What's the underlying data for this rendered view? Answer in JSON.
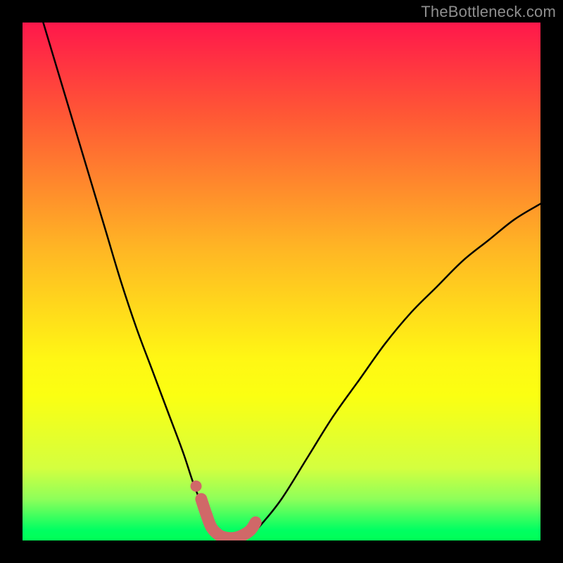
{
  "watermark": "TheBottleneck.com",
  "colors": {
    "gradient_top": "#ff174b",
    "gradient_bottom": "#00ff56",
    "curve": "#000000",
    "highlight": "#d06868",
    "frame": "#000000"
  },
  "chart_data": {
    "type": "line",
    "title": "",
    "xlabel": "",
    "ylabel": "",
    "xlim": [
      0,
      100
    ],
    "ylim": [
      0,
      100
    ],
    "grid": false,
    "legend": false,
    "annotations": [],
    "series": [
      {
        "name": "bottleneck-curve",
        "x": [
          4,
          7,
          10,
          13,
          16,
          19,
          22,
          25,
          28,
          31,
          33,
          35,
          36.5,
          38,
          40,
          42,
          44,
          46,
          50,
          55,
          60,
          65,
          70,
          75,
          80,
          85,
          90,
          95,
          100
        ],
        "y": [
          100,
          90,
          80,
          70,
          60,
          50,
          41,
          33,
          25,
          17,
          11,
          6,
          3,
          1,
          0,
          0,
          1,
          3,
          8,
          16,
          24,
          31,
          38,
          44,
          49,
          54,
          58,
          62,
          65
        ]
      },
      {
        "name": "highlight-segment",
        "x": [
          34.5,
          35.5,
          36.5,
          38,
          39.5,
          41,
          42.5,
          44,
          45
        ],
        "y": [
          8,
          5,
          2.5,
          1,
          0.5,
          0.5,
          1,
          2,
          3.5
        ]
      },
      {
        "name": "highlight-dot",
        "x": [
          33.5
        ],
        "y": [
          10.5
        ]
      }
    ]
  }
}
